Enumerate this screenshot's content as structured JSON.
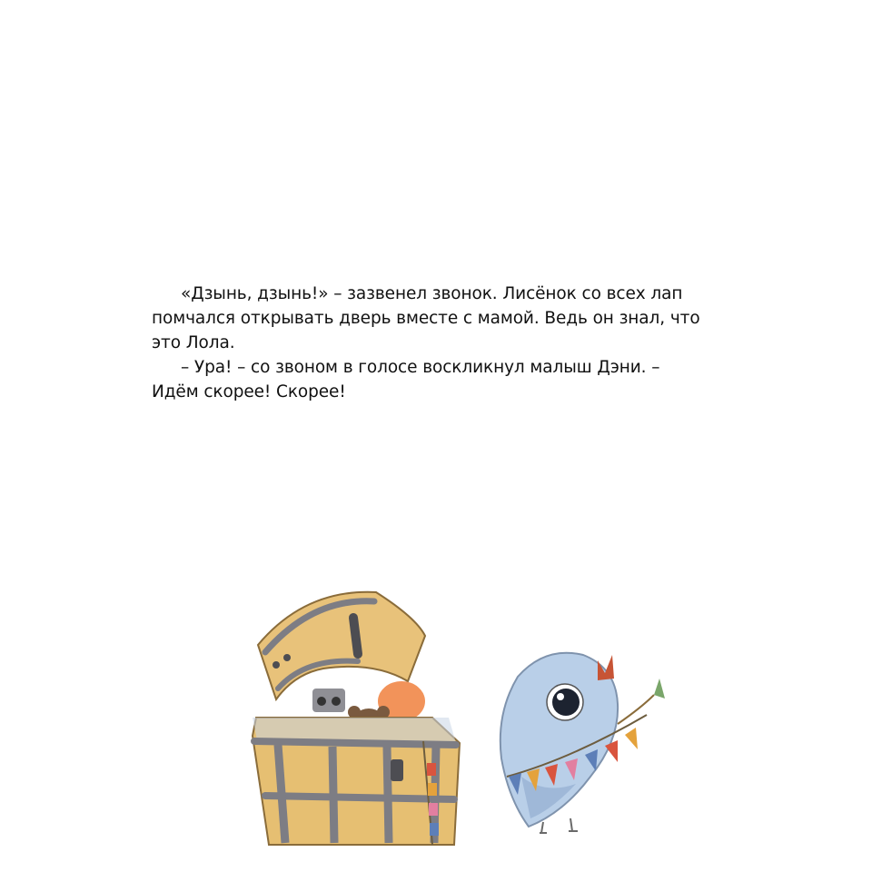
{
  "story": {
    "paragraphs": [
      {
        "lines": [
          "«Дзынь, дзынь!» – зазвенел звонок. Лисёнок со всех лап",
          "помчался открывать дверь вместе с мамой. Ведь он знал, что",
          "это Лола."
        ]
      },
      {
        "lines": [
          "– Ура! – со звоном в голосе воскликнул малыш Дэни. –",
          "Идём скорее! Скорее!"
        ]
      }
    ]
  },
  "illustrations": {
    "chest": {
      "icon": "treasure-chest-with-toys",
      "colors": {
        "wood": "#e6bf72",
        "metal": "#7d7d84",
        "toys": "#7a5a3f"
      }
    },
    "bird": {
      "icon": "blue-bird-with-bunting",
      "colors": {
        "body": "#b9cfe8",
        "beak": "#c75435",
        "flags": [
          "#d9543e",
          "#e4a23c",
          "#5d7fb8",
          "#e27fa0",
          "#7aa66a"
        ]
      }
    }
  }
}
